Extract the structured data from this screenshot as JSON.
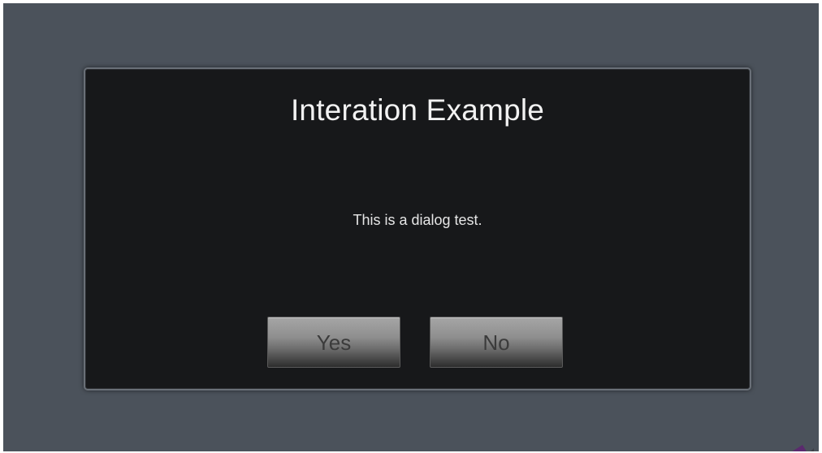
{
  "dialog": {
    "title": "Interation Example",
    "message": "This is a dialog test.",
    "yes_label": "Yes",
    "no_label": "No"
  },
  "colors": {
    "backdrop": "#4b525b",
    "dialog_bg": "#17181a",
    "dialog_border": "#6a7078",
    "title_text": "#f2f2f2",
    "button_text": "#3b3b3b",
    "corner_accent": "#5b2a6e"
  },
  "icons": {
    "corner": "purple-arrow-fragment-icon"
  }
}
